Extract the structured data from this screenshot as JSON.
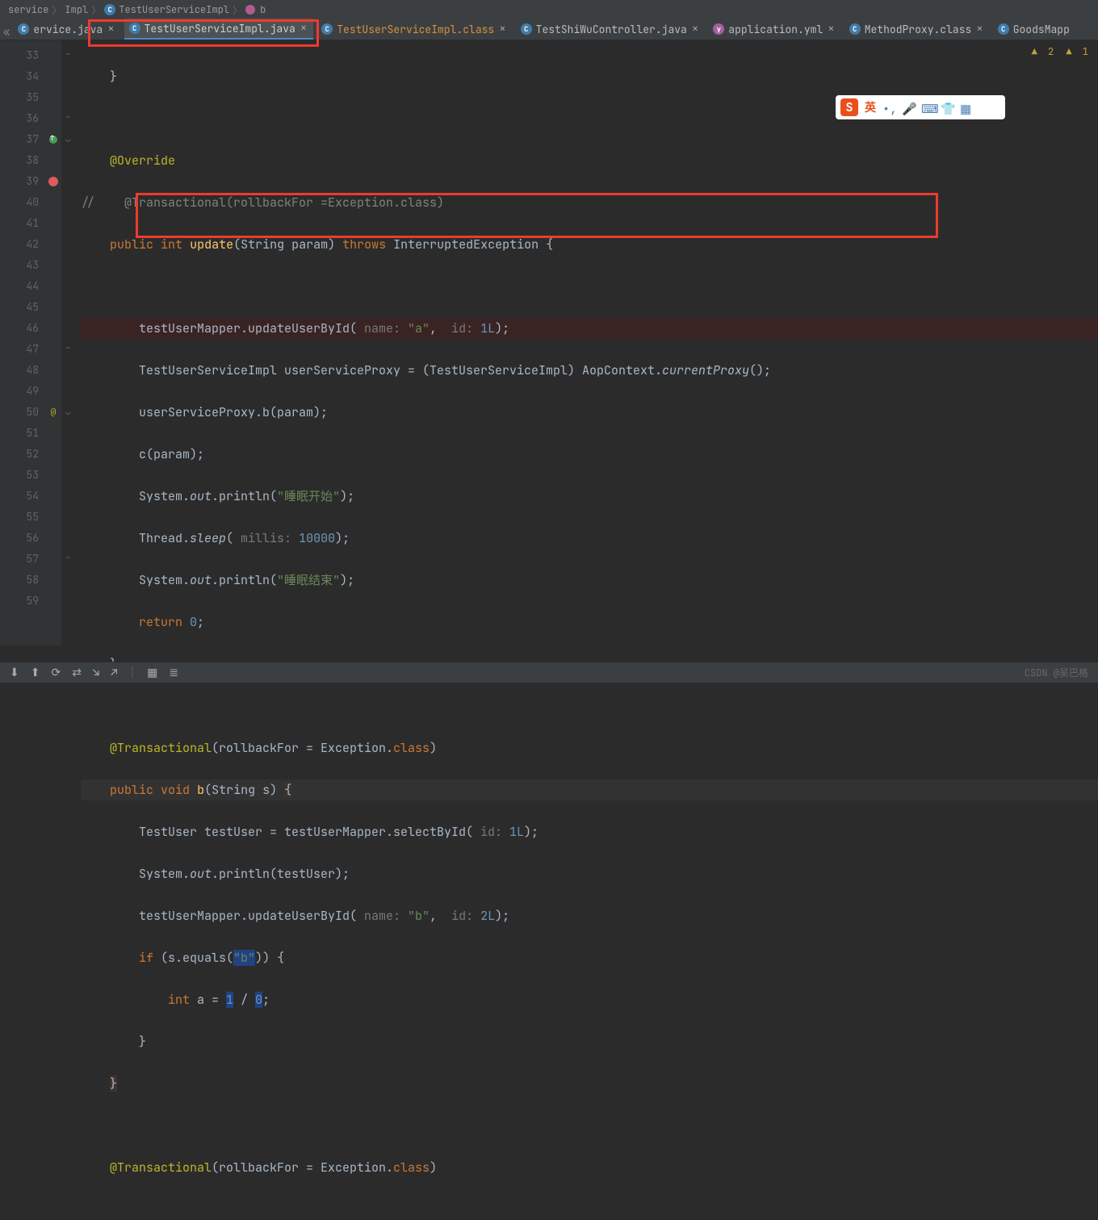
{
  "breadcrumb": {
    "parts": [
      "service",
      "Impl",
      "TestUserServiceImpl",
      "b"
    ]
  },
  "tabs": [
    {
      "label": "ervice.java",
      "icon": "c",
      "active": false
    },
    {
      "label": "TestUserServiceImpl.java",
      "icon": "c",
      "active": true
    },
    {
      "label": "TestUserServiceImpl.class",
      "icon": "c",
      "active": false,
      "cls": "orange"
    },
    {
      "label": "TestShiWuController.java",
      "icon": "c",
      "active": false
    },
    {
      "label": "application.yml",
      "icon": "y",
      "active": false
    },
    {
      "label": "MethodProxy.class",
      "icon": "c",
      "active": false
    },
    {
      "label": "GoodsMapp",
      "icon": "c",
      "active": false,
      "noclose": true
    }
  ],
  "warnings": {
    "w1": "2",
    "w2": "1"
  },
  "gutter": {
    "start": 33,
    "end": 59
  },
  "code": {
    "l33": "    }",
    "l35_anno": "@Override",
    "l36_cm": "//    @Transactional(rollbackFor =Exception.class)",
    "l37": {
      "kw1": "public",
      "kw2": "int",
      "fn": "update",
      "sig": "(String param) ",
      "kw3": "throws",
      "exc": " InterruptedException {"
    },
    "l39": {
      "a": "        testUserMapper.updateUserById(",
      "h1": " name: ",
      "s1": "\"a\"",
      "c1": ", ",
      "h2": " id: ",
      "n1": "1L",
      "e": ");"
    },
    "l40": "        TestUserServiceImpl userServiceProxy = (TestUserServiceImpl) AopContext.",
    "l40_it": "currentProxy",
    "l40_e": "();",
    "l41": "        userServiceProxy.b(param);",
    "l42": "        c(param);",
    "l43": {
      "a": "        System.",
      "it": "out",
      "b": ".println(",
      "s": "\"睡眠开始\"",
      "e": ");"
    },
    "l44": {
      "a": "        Thread.",
      "it": "sleep",
      "b": "(",
      "h": " millis: ",
      "n": "10000",
      "e": ");"
    },
    "l45": {
      "a": "        System.",
      "it": "out",
      "b": ".println(",
      "s": "\"睡眠结束\"",
      "e": ");"
    },
    "l46": {
      "kw": "return ",
      "n": "0",
      "e": ";"
    },
    "l47": "    }",
    "l49": {
      "anno": "@Transactional",
      "a": "(rollbackFor = Exception.",
      "kw": "class",
      "e": ")"
    },
    "l50": {
      "kw1": "public",
      "kw2": "void",
      "fn": "b",
      "sig": "(String s) ",
      "br": "{"
    },
    "l51": {
      "a": "        TestUser testUser = testUserMapper.selectById(",
      "h": " id: ",
      "n": "1L",
      "e": ");"
    },
    "l52": {
      "a": "        System.",
      "it": "out",
      "b": ".println(testUser);"
    },
    "l53": {
      "a": "        testUserMapper.updateUserById(",
      "h1": " name: ",
      "s1": "\"b\"",
      "c1": ", ",
      "h2": " id: ",
      "n1": "2L",
      "e": ");"
    },
    "l54": {
      "kw": "if ",
      "a": "(s.equals(",
      "s": "\"b\"",
      "b": ")) {"
    },
    "l55": {
      "kw": "int ",
      "a": "a = ",
      "n1": "1",
      "op": " / ",
      "n2": "0",
      "e": ";"
    },
    "l56": "        }",
    "l57": "    ",
    "br": "}",
    "l59": {
      "anno": "@Transactional",
      "a": "(rollbackFor = Exception.",
      "kw": "class",
      "e": ")"
    }
  },
  "ime": {
    "logo": "S",
    "lang": "英"
  },
  "statusbar": {
    "right": "CSDN @吴巴格"
  }
}
